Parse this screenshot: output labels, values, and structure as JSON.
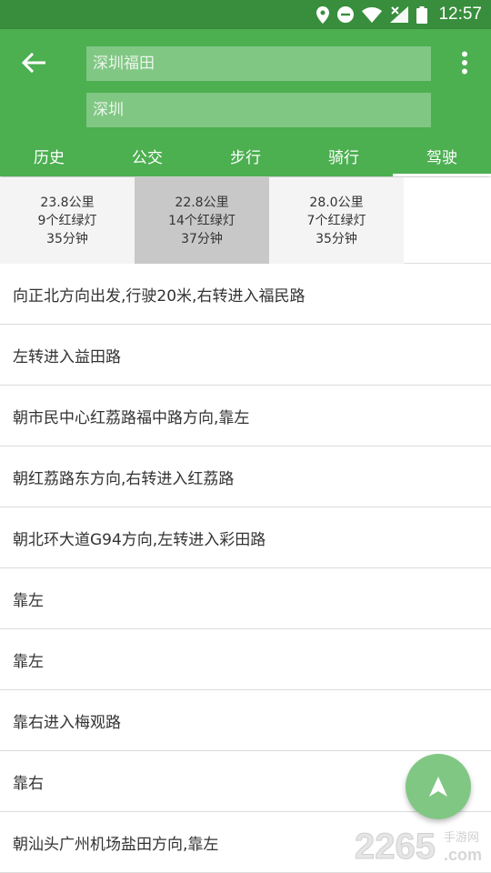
{
  "status_bar": {
    "time": "12:57",
    "icons": [
      "location-icon",
      "do-not-disturb-icon",
      "wifi-icon",
      "no-signal-icon",
      "battery-icon"
    ]
  },
  "header": {
    "from_value": "",
    "from_placeholder": "深圳福田",
    "to_value": "",
    "to_placeholder": "深圳"
  },
  "tabs": [
    {
      "label": "历史",
      "active": false
    },
    {
      "label": "公交",
      "active": false
    },
    {
      "label": "步行",
      "active": false
    },
    {
      "label": "骑行",
      "active": false
    },
    {
      "label": "驾驶",
      "active": true
    }
  ],
  "routes": [
    {
      "distance": "23.8公里",
      "lights": "9个红绿灯",
      "time": "35分钟",
      "selected": false
    },
    {
      "distance": "22.8公里",
      "lights": "14个红绿灯",
      "time": "37分钟",
      "selected": true
    },
    {
      "distance": "28.0公里",
      "lights": "7个红绿灯",
      "time": "35分钟",
      "selected": false
    }
  ],
  "steps": [
    "向正北方向出发,行驶20米,右转进入福民路",
    "左转进入益田路",
    "朝市民中心红荔路福中路方向,靠左",
    "朝红荔路东方向,右转进入红荔路",
    "朝北环大道G94方向,左转进入彩田路",
    "靠左",
    "靠左",
    "靠右进入梅观路",
    "靠右",
    "朝汕头广州机场盐田方向,靠左"
  ],
  "watermark": {
    "number": "2265",
    "suffix": ".com",
    "site": "手游网"
  },
  "colors": {
    "status_bar": "#388e3c",
    "primary": "#4caf50",
    "input_bg": "#81c784",
    "fab": "#81c784",
    "selected_route": "#c8c8c8",
    "route_card": "#f4f4f4"
  }
}
